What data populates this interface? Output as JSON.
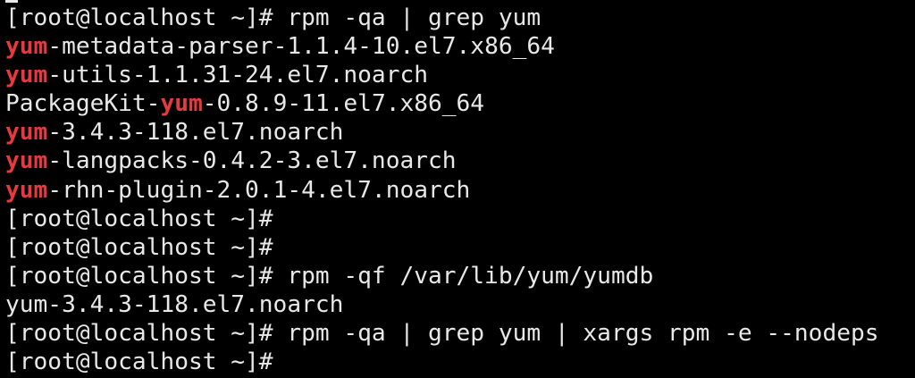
{
  "terminal": {
    "colors": {
      "background": "#000000",
      "text": "#e8e8e8",
      "match_highlight": "#e8393f"
    },
    "lines": [
      {
        "parts": [
          {
            "t": "[root@localhost ~]# rpm -qa | grep yum",
            "hl": false
          }
        ]
      },
      {
        "parts": [
          {
            "t": "yum",
            "hl": true
          },
          {
            "t": "-metadata-parser-1.1.4-10.el7.x86_64",
            "hl": false
          }
        ]
      },
      {
        "parts": [
          {
            "t": "yum",
            "hl": true
          },
          {
            "t": "-utils-1.1.31-24.el7.noarch",
            "hl": false
          }
        ]
      },
      {
        "parts": [
          {
            "t": "PackageKit-",
            "hl": false
          },
          {
            "t": "yum",
            "hl": true
          },
          {
            "t": "-0.8.9-11.el7.x86_64",
            "hl": false
          }
        ]
      },
      {
        "parts": [
          {
            "t": "yum",
            "hl": true
          },
          {
            "t": "-3.4.3-118.el7.noarch",
            "hl": false
          }
        ]
      },
      {
        "parts": [
          {
            "t": "yum",
            "hl": true
          },
          {
            "t": "-langpacks-0.4.2-3.el7.noarch",
            "hl": false
          }
        ]
      },
      {
        "parts": [
          {
            "t": "yum",
            "hl": true
          },
          {
            "t": "-rhn-plugin-2.0.1-4.el7.noarch",
            "hl": false
          }
        ]
      },
      {
        "parts": [
          {
            "t": "[root@localhost ~]#",
            "hl": false
          }
        ]
      },
      {
        "parts": [
          {
            "t": "[root@localhost ~]#",
            "hl": false
          }
        ]
      },
      {
        "parts": [
          {
            "t": "[root@localhost ~]# rpm -qf /var/lib/yum/yumdb",
            "hl": false
          }
        ]
      },
      {
        "parts": [
          {
            "t": "yum-3.4.3-118.el7.noarch",
            "hl": false
          }
        ]
      },
      {
        "parts": [
          {
            "t": "[root@localhost ~]# rpm -qa | grep yum | xargs rpm -e --nodeps",
            "hl": false
          }
        ]
      },
      {
        "parts": [
          {
            "t": "[root@localhost ~]#",
            "hl": false
          }
        ]
      }
    ]
  }
}
